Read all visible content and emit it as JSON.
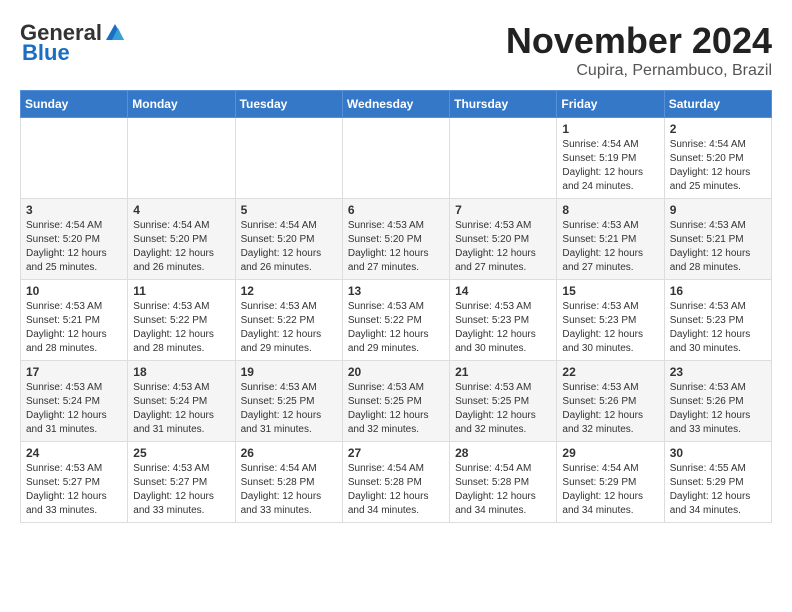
{
  "header": {
    "logo_general": "General",
    "logo_blue": "Blue",
    "month_title": "November 2024",
    "location": "Cupira, Pernambuco, Brazil"
  },
  "weekdays": [
    "Sunday",
    "Monday",
    "Tuesday",
    "Wednesday",
    "Thursday",
    "Friday",
    "Saturday"
  ],
  "weeks": [
    [
      {
        "day": "",
        "info": ""
      },
      {
        "day": "",
        "info": ""
      },
      {
        "day": "",
        "info": ""
      },
      {
        "day": "",
        "info": ""
      },
      {
        "day": "",
        "info": ""
      },
      {
        "day": "1",
        "info": "Sunrise: 4:54 AM\nSunset: 5:19 PM\nDaylight: 12 hours\nand 24 minutes."
      },
      {
        "day": "2",
        "info": "Sunrise: 4:54 AM\nSunset: 5:20 PM\nDaylight: 12 hours\nand 25 minutes."
      }
    ],
    [
      {
        "day": "3",
        "info": "Sunrise: 4:54 AM\nSunset: 5:20 PM\nDaylight: 12 hours\nand 25 minutes."
      },
      {
        "day": "4",
        "info": "Sunrise: 4:54 AM\nSunset: 5:20 PM\nDaylight: 12 hours\nand 26 minutes."
      },
      {
        "day": "5",
        "info": "Sunrise: 4:54 AM\nSunset: 5:20 PM\nDaylight: 12 hours\nand 26 minutes."
      },
      {
        "day": "6",
        "info": "Sunrise: 4:53 AM\nSunset: 5:20 PM\nDaylight: 12 hours\nand 27 minutes."
      },
      {
        "day": "7",
        "info": "Sunrise: 4:53 AM\nSunset: 5:20 PM\nDaylight: 12 hours\nand 27 minutes."
      },
      {
        "day": "8",
        "info": "Sunrise: 4:53 AM\nSunset: 5:21 PM\nDaylight: 12 hours\nand 27 minutes."
      },
      {
        "day": "9",
        "info": "Sunrise: 4:53 AM\nSunset: 5:21 PM\nDaylight: 12 hours\nand 28 minutes."
      }
    ],
    [
      {
        "day": "10",
        "info": "Sunrise: 4:53 AM\nSunset: 5:21 PM\nDaylight: 12 hours\nand 28 minutes."
      },
      {
        "day": "11",
        "info": "Sunrise: 4:53 AM\nSunset: 5:22 PM\nDaylight: 12 hours\nand 28 minutes."
      },
      {
        "day": "12",
        "info": "Sunrise: 4:53 AM\nSunset: 5:22 PM\nDaylight: 12 hours\nand 29 minutes."
      },
      {
        "day": "13",
        "info": "Sunrise: 4:53 AM\nSunset: 5:22 PM\nDaylight: 12 hours\nand 29 minutes."
      },
      {
        "day": "14",
        "info": "Sunrise: 4:53 AM\nSunset: 5:23 PM\nDaylight: 12 hours\nand 30 minutes."
      },
      {
        "day": "15",
        "info": "Sunrise: 4:53 AM\nSunset: 5:23 PM\nDaylight: 12 hours\nand 30 minutes."
      },
      {
        "day": "16",
        "info": "Sunrise: 4:53 AM\nSunset: 5:23 PM\nDaylight: 12 hours\nand 30 minutes."
      }
    ],
    [
      {
        "day": "17",
        "info": "Sunrise: 4:53 AM\nSunset: 5:24 PM\nDaylight: 12 hours\nand 31 minutes."
      },
      {
        "day": "18",
        "info": "Sunrise: 4:53 AM\nSunset: 5:24 PM\nDaylight: 12 hours\nand 31 minutes."
      },
      {
        "day": "19",
        "info": "Sunrise: 4:53 AM\nSunset: 5:25 PM\nDaylight: 12 hours\nand 31 minutes."
      },
      {
        "day": "20",
        "info": "Sunrise: 4:53 AM\nSunset: 5:25 PM\nDaylight: 12 hours\nand 32 minutes."
      },
      {
        "day": "21",
        "info": "Sunrise: 4:53 AM\nSunset: 5:25 PM\nDaylight: 12 hours\nand 32 minutes."
      },
      {
        "day": "22",
        "info": "Sunrise: 4:53 AM\nSunset: 5:26 PM\nDaylight: 12 hours\nand 32 minutes."
      },
      {
        "day": "23",
        "info": "Sunrise: 4:53 AM\nSunset: 5:26 PM\nDaylight: 12 hours\nand 33 minutes."
      }
    ],
    [
      {
        "day": "24",
        "info": "Sunrise: 4:53 AM\nSunset: 5:27 PM\nDaylight: 12 hours\nand 33 minutes."
      },
      {
        "day": "25",
        "info": "Sunrise: 4:53 AM\nSunset: 5:27 PM\nDaylight: 12 hours\nand 33 minutes."
      },
      {
        "day": "26",
        "info": "Sunrise: 4:54 AM\nSunset: 5:28 PM\nDaylight: 12 hours\nand 33 minutes."
      },
      {
        "day": "27",
        "info": "Sunrise: 4:54 AM\nSunset: 5:28 PM\nDaylight: 12 hours\nand 34 minutes."
      },
      {
        "day": "28",
        "info": "Sunrise: 4:54 AM\nSunset: 5:28 PM\nDaylight: 12 hours\nand 34 minutes."
      },
      {
        "day": "29",
        "info": "Sunrise: 4:54 AM\nSunset: 5:29 PM\nDaylight: 12 hours\nand 34 minutes."
      },
      {
        "day": "30",
        "info": "Sunrise: 4:55 AM\nSunset: 5:29 PM\nDaylight: 12 hours\nand 34 minutes."
      }
    ]
  ]
}
